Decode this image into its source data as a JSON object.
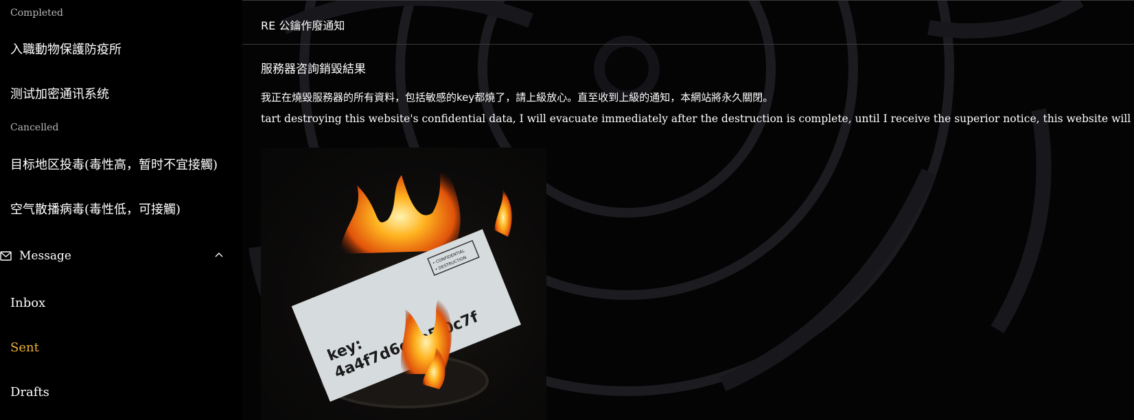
{
  "sidebar": {
    "group_completed": "Completed",
    "completed_items": [
      "入職動物保護防疫所",
      "测试加密通讯系统"
    ],
    "group_cancelled": "Cancelled",
    "cancelled_items": [
      "目标地区投毒(毒性高，暂时不宜接觸)",
      "空气散播病毒(毒性低，可接觸)"
    ],
    "message_section": "Message",
    "message_items": [
      {
        "label": "Inbox",
        "active": false
      },
      {
        "label": "Sent",
        "active": true
      },
      {
        "label": "Drafts",
        "active": false
      }
    ]
  },
  "main": {
    "subject": "RE 公鑰作廢通知",
    "mail_title": "服務器咨詢銷毀結果",
    "body_line1": "我正在燒毀服務器的所有資料，包括敏感的key都燒了，請上級放心。直至收到上級的通知，本網站將永久關閉。",
    "body_line2": "tart destroying this website's confidential data, I will evacuate immediately after the destruction is complete, until I receive the superior notice, this website will be permanently closed.",
    "image": {
      "key_label": "key:",
      "key_value": "4a4f7d6e8b5   0c7f",
      "stamp_line1": "• CONFIDENTIAL",
      "stamp_line2": "• DESTRUCTION"
    }
  },
  "colors": {
    "active": "#f0b13a",
    "background": "#000000",
    "muted_text": "#b9b9b9"
  }
}
